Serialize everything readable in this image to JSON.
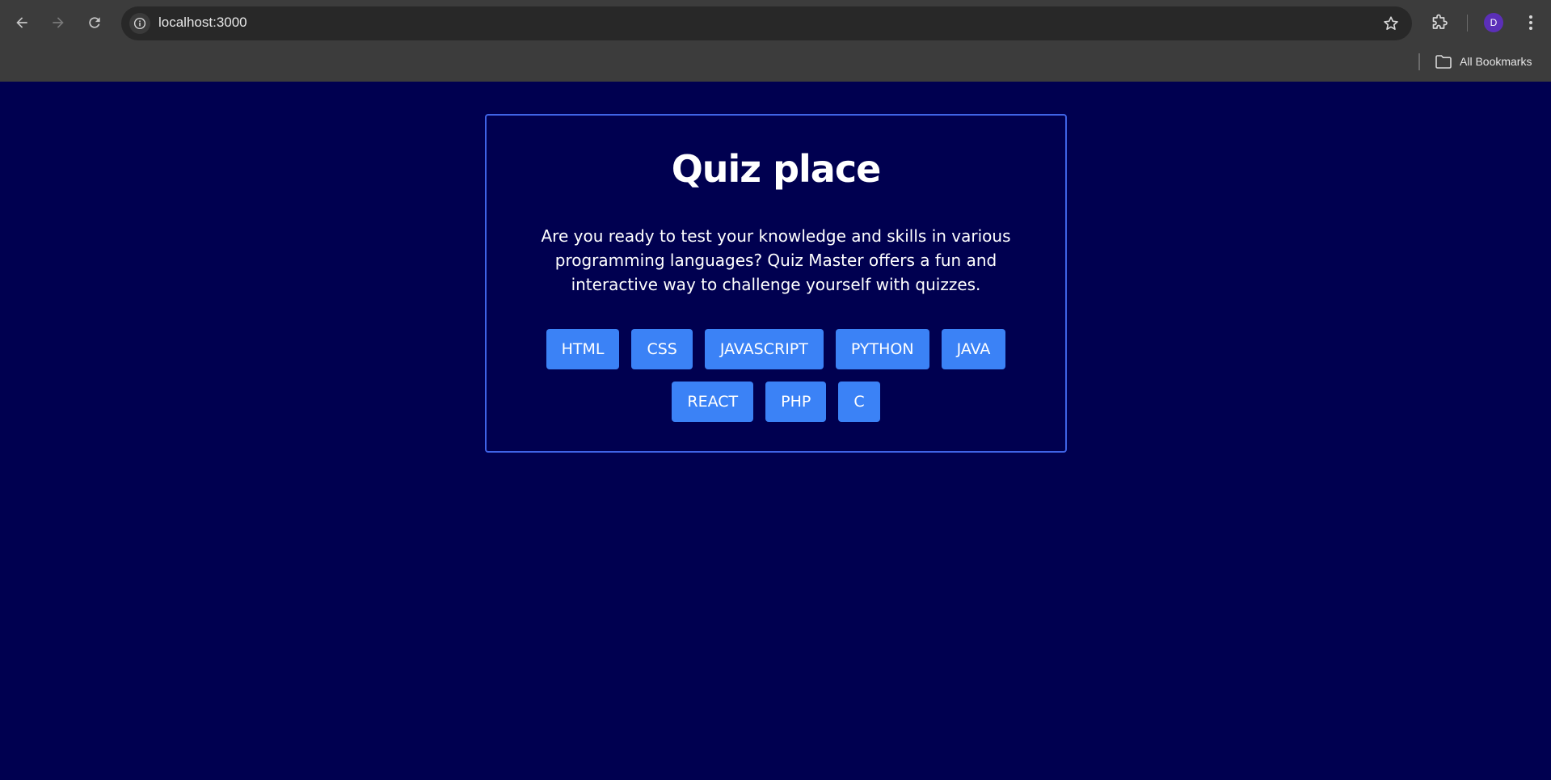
{
  "browser": {
    "url": "localhost:3000",
    "profile_initial": "D",
    "bookmarks_label": "All Bookmarks",
    "icons": {
      "back": "arrow-left-icon",
      "forward": "arrow-right-icon",
      "reload": "reload-icon",
      "site_info": "info-icon",
      "bookmark": "star-icon",
      "extensions": "puzzle-icon",
      "menu": "kebab-menu-icon",
      "bookmarks_folder": "folder-icon"
    }
  },
  "page": {
    "title": "Quiz place",
    "description": "Are you ready to test your knowledge and skills in various programming languages? Quiz Master offers a fun and interactive way to challenge yourself with quizzes.",
    "buttons_row1": [
      "HTML",
      "CSS",
      "JAVASCRIPT",
      "PYTHON",
      "JAVA"
    ],
    "buttons_row2": [
      "REACT",
      "PHP",
      "C"
    ]
  },
  "colors": {
    "background": "#000050",
    "card_border": "#3f63e6",
    "button": "#3b82f6",
    "text": "#ffffff"
  }
}
